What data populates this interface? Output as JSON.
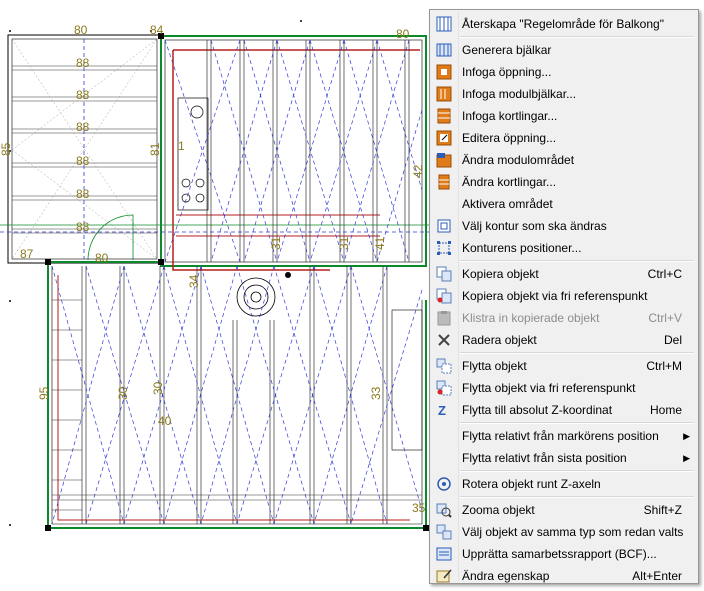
{
  "canvas_labels": {
    "top_a": "80",
    "top_b": "84",
    "top_c": "80",
    "left_a": "85",
    "left_b": "87",
    "left_c": "84",
    "left_d": "95",
    "mid_a": "81",
    "mid_b": "80",
    "d88_1": "88",
    "d88_2": "88",
    "d88_3": "88",
    "d88_4": "88",
    "d88_5": "88",
    "d88_6": "88",
    "n30": "30",
    "n30b": "30",
    "n40": "40",
    "n31a": "31",
    "n31b": "31",
    "n42": "42",
    "n41": "41",
    "n33": "33",
    "n35": "35",
    "n34": "34",
    "n1": "1"
  },
  "context_menu": {
    "items": [
      {
        "label": "Återskapa \"Regelområde för Balkong\"",
        "shortcut": "",
        "icon": "restore-area-icon",
        "disabled": false
      },
      {
        "sep": true
      },
      {
        "label": "Generera bjälkar",
        "shortcut": "",
        "icon": "generate-beams-icon",
        "disabled": false
      },
      {
        "label": "Infoga öppning...",
        "shortcut": "",
        "icon": "insert-opening-icon",
        "disabled": false
      },
      {
        "label": "Infoga modulbjälkar...",
        "shortcut": "",
        "icon": "insert-module-beams-icon",
        "disabled": false
      },
      {
        "label": "Infoga kortlingar...",
        "shortcut": "",
        "icon": "insert-noggings-icon",
        "disabled": false
      },
      {
        "label": "Editera öppning...",
        "shortcut": "",
        "icon": "edit-opening-icon",
        "disabled": false
      },
      {
        "label": "Ändra modulområdet",
        "shortcut": "",
        "icon": "change-module-area-icon",
        "disabled": false
      },
      {
        "label": "Ändra kortlingar...",
        "shortcut": "",
        "icon": "change-noggings-icon",
        "disabled": false
      },
      {
        "label": "Aktivera området",
        "shortcut": "",
        "icon": "",
        "disabled": false
      },
      {
        "label": "Välj kontur som ska ändras",
        "shortcut": "",
        "icon": "select-contour-icon",
        "disabled": false
      },
      {
        "label": "Konturens positioner...",
        "shortcut": "",
        "icon": "contour-positions-icon",
        "disabled": false
      },
      {
        "sep": true
      },
      {
        "label": "Kopiera objekt",
        "shortcut": "Ctrl+C",
        "icon": "copy-icon",
        "disabled": false
      },
      {
        "label": "Kopiera objekt via fri referenspunkt",
        "shortcut": "",
        "icon": "copy-reference-icon",
        "disabled": false
      },
      {
        "label": "Klistra in kopierade objekt",
        "shortcut": "Ctrl+V",
        "icon": "paste-icon",
        "disabled": true
      },
      {
        "label": "Radera objekt",
        "shortcut": "Del",
        "icon": "delete-icon",
        "disabled": false
      },
      {
        "sep": true
      },
      {
        "label": "Flytta objekt",
        "shortcut": "Ctrl+M",
        "icon": "move-icon",
        "disabled": false
      },
      {
        "label": "Flytta objekt via fri referenspunkt",
        "shortcut": "",
        "icon": "move-reference-icon",
        "disabled": false
      },
      {
        "label": "Flytta till absolut Z-koordinat",
        "shortcut": "Home",
        "icon": "z-coordinate-icon",
        "disabled": false
      },
      {
        "sep": true
      },
      {
        "label": "Flytta relativt från markörens position",
        "shortcut": "",
        "icon": "",
        "disabled": false,
        "submenu": true
      },
      {
        "label": "Flytta relativt från sista position",
        "shortcut": "",
        "icon": "",
        "disabled": false,
        "submenu": true
      },
      {
        "sep": true
      },
      {
        "label": "Rotera objekt runt Z-axeln",
        "shortcut": "",
        "icon": "rotate-icon",
        "disabled": false
      },
      {
        "sep": true
      },
      {
        "label": "Zooma objekt",
        "shortcut": "Shift+Z",
        "icon": "zoom-icon",
        "disabled": false
      },
      {
        "label": "Välj objekt av samma typ som redan valts",
        "shortcut": "",
        "icon": "select-same-type-icon",
        "disabled": false
      },
      {
        "label": "Upprätta samarbetssrapport (BCF)...",
        "shortcut": "",
        "icon": "bcf-report-icon",
        "disabled": false
      },
      {
        "label": "Ändra egenskap",
        "shortcut": "Alt+Enter",
        "icon": "properties-icon",
        "disabled": false
      }
    ]
  },
  "colors": {
    "beam_dash": "#2f3bd6",
    "wall_green": "#0a8a2a",
    "wall_red": "#b81e1e",
    "label_olive": "#8a7a1c",
    "icon_orange": "#e07b1a",
    "icon_blue": "#2b5db8"
  }
}
